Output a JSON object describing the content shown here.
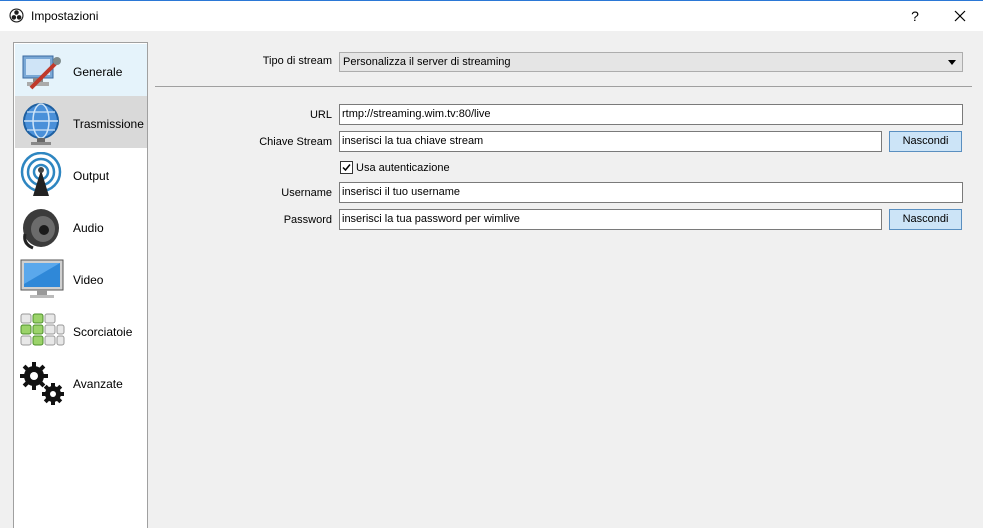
{
  "window": {
    "title": "Impostazioni",
    "help_label": "?"
  },
  "sidebar": {
    "items": [
      {
        "label": "Generale",
        "icon": "general-settings-icon"
      },
      {
        "label": "Trasmissione",
        "icon": "globe-icon"
      },
      {
        "label": "Output",
        "icon": "broadcast-tower-icon"
      },
      {
        "label": "Audio",
        "icon": "speaker-icon"
      },
      {
        "label": "Video",
        "icon": "monitor-icon"
      },
      {
        "label": "Scorciatoie",
        "icon": "keyboard-icon"
      },
      {
        "label": "Avanzate",
        "icon": "gears-icon"
      }
    ],
    "selected": "Trasmissione"
  },
  "stream": {
    "type_label": "Tipo di stream",
    "type_value": "Personalizza il server di streaming",
    "url_label": "URL",
    "url_value": "rtmp://streaming.wim.tv:80/live",
    "key_label": "Chiave Stream",
    "key_value": "inserisci la tua chiave stream",
    "key_button": "Nascondi",
    "auth_label": "Usa autenticazione",
    "auth_checked": true,
    "username_label": "Username",
    "username_value": "inserisci il tuo username",
    "password_label": "Password",
    "password_value": "inserisci la tua password per wimlive",
    "password_button": "Nascondi"
  }
}
